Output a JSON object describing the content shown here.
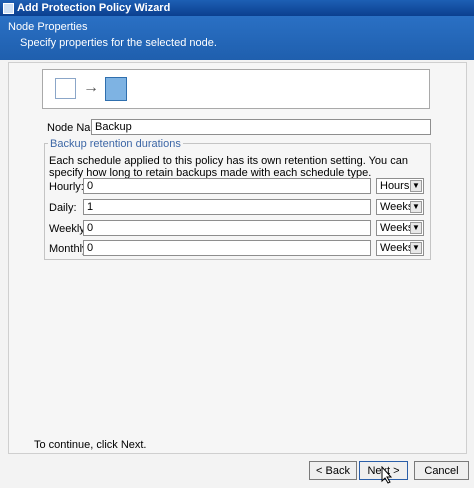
{
  "window": {
    "title": "Add Protection Policy Wizard"
  },
  "header": {
    "title": "Node Properties",
    "subtitle": "Specify properties for the selected node."
  },
  "node": {
    "name_label": "Node Name:",
    "name_value": "Backup"
  },
  "retention": {
    "legend": "Backup retention durations",
    "description": "Each schedule applied to this policy has its own retention setting. You can specify how long to retain backups made with each schedule type.",
    "rows": [
      {
        "label": "Hourly:",
        "value": "0",
        "unit": "Hours"
      },
      {
        "label": "Daily:",
        "value": "1",
        "unit": "Weeks"
      },
      {
        "label": "Weekly:",
        "value": "0",
        "unit": "Weeks"
      },
      {
        "label": "Monthly:",
        "value": "0",
        "unit": "Weeks"
      }
    ]
  },
  "footer": {
    "hint": "To continue, click Next."
  },
  "buttons": {
    "back": "< Back",
    "next": "Next >",
    "cancel": "Cancel"
  },
  "icons": {
    "dropdown": "chevron-down-icon",
    "arrow": "arrow-right-icon",
    "cursor": "mouse-pointer-icon"
  },
  "colors": {
    "header": "#1f5fae",
    "titlebar": "#0b3f8f",
    "legend": "#3d67a6",
    "node_box": "#7eb3e3"
  }
}
